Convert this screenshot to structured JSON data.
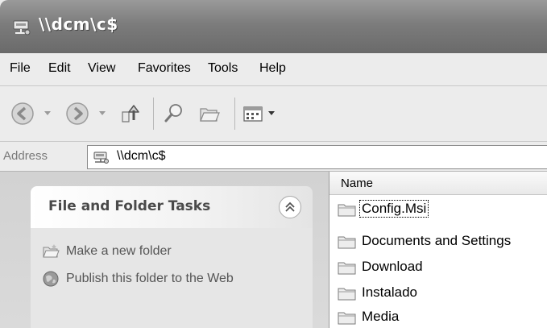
{
  "window": {
    "title": "\\\\dcm\\c$",
    "icon": "network-drive-icon"
  },
  "menu": {
    "items": [
      "File",
      "Edit",
      "View",
      "Favorites",
      "Tools",
      "Help"
    ]
  },
  "toolbar": {
    "buttons": [
      "back-icon",
      "forward-icon",
      "up-folder-icon",
      "search-icon",
      "folders-icon",
      "views-icon"
    ]
  },
  "address": {
    "label": "Address",
    "value": "\\\\dcm\\c$"
  },
  "taskpane": {
    "header": "File and Folder Tasks",
    "tasks": [
      {
        "label": "Make a new folder",
        "icon": "new-folder-icon"
      },
      {
        "label": "Publish this folder to the Web",
        "icon": "publish-globe-icon"
      }
    ]
  },
  "filelist": {
    "column": "Name",
    "items": [
      "Config.Msi",
      "Documents and Settings",
      "Download",
      "Instalado",
      "Media"
    ],
    "selected": "Config.Msi"
  }
}
